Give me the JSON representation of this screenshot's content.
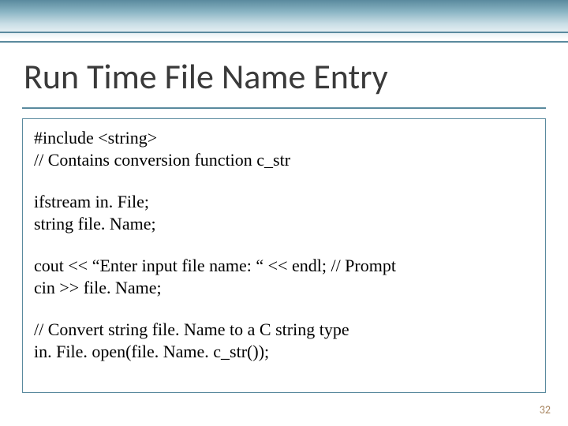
{
  "slide": {
    "title": "Run Time File Name Entry",
    "pageNumber": "32"
  },
  "code": {
    "l1": "#include <string>",
    "l2": "// Contains conversion function c_str",
    "l3": "ifstream  in. File;",
    "l4": "string    file. Name;",
    "l5": "cout << “Enter input file name: “ << endl; // Prompt",
    "l6": "cin   >>  file. Name;",
    "l7": "// Convert string file. Name to a C string type",
    "l8": "in. File. open(file. Name. c_str());"
  }
}
